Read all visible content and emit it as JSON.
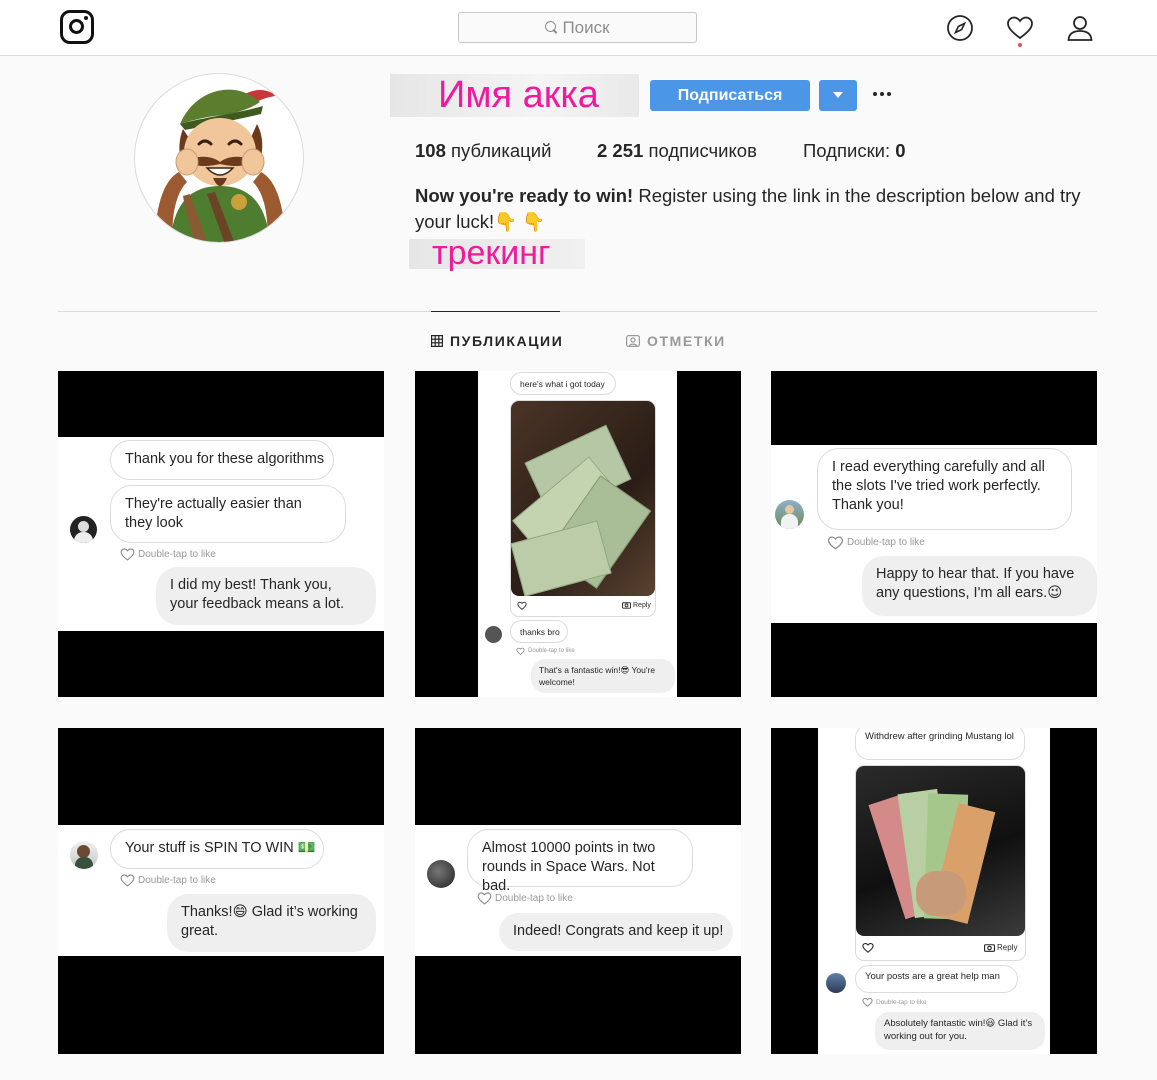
{
  "nav": {
    "search_placeholder": "Поиск"
  },
  "profile": {
    "username": "Имя акка",
    "follow_label": "Подписаться",
    "stats": {
      "posts_count": "108",
      "posts_label": "публикаций",
      "followers_count": "2 251",
      "followers_label": "подписчиков",
      "following_label": "Подписки:",
      "following_count": "0"
    },
    "bio_bold": "Now you're ready to win!",
    "bio_rest": "Register using the link in the description below and try your luck!👇 👇",
    "tracking_label": "трекинг"
  },
  "tabs": {
    "posts": "ПУБЛИКАЦИИ",
    "tagged": "ОТМЕТКИ"
  },
  "posts": [
    {
      "in1": "Thank you for these algorithms",
      "in2": "They're actually easier than they look",
      "like_hint": "Double-tap to like",
      "out": "I did my best! Thank you, your feedback means a lot."
    },
    {
      "top": "here's what i got today",
      "reply": "Reply",
      "in": "thanks bro",
      "like_hint": "Double-tap to like",
      "out": "That's a fantastic win!😎 You're welcome!"
    },
    {
      "in": "I read everything carefully and all the slots I've tried work perfectly. Thank you!",
      "like_hint": "Double-tap to like",
      "out": "Happy to hear that. If you have any questions, I'm all ears.😉"
    },
    {
      "in": "Your stuff is SPIN TO WIN 💵",
      "like_hint": "Double-tap to like",
      "out": "Thanks!😄 Glad it’s working great."
    },
    {
      "in": "Almost 10000 points in two rounds in Space Wars. Not bad.",
      "like_hint": "Double-tap to like",
      "out": "Indeed! Congrats and keep it up!"
    },
    {
      "top": "Withdrew after grinding Mustang lol",
      "reply": "Reply",
      "in": "Your posts are a great help man",
      "like_hint": "Double-tap to like",
      "out": "Absolutely fantastic win!😃 Glad it’s working out for you."
    }
  ]
}
